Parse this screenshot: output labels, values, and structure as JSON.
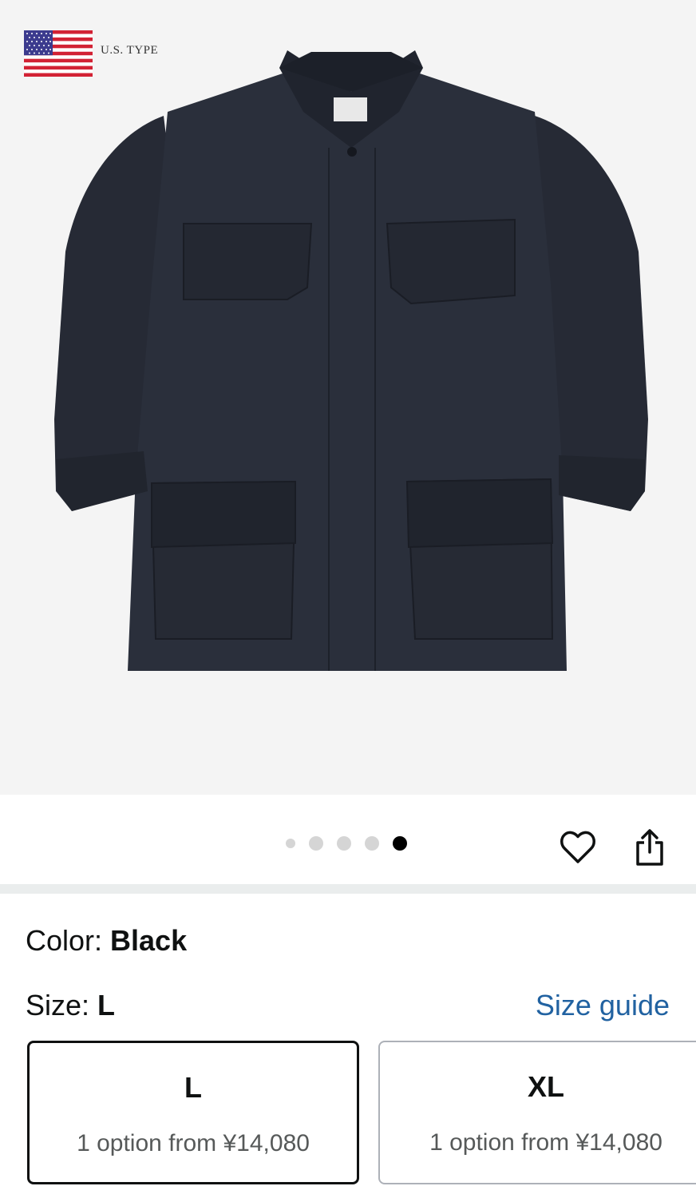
{
  "product_image": {
    "badge_text": "U.S. TYPE",
    "flag_icon": "us-flag-icon",
    "carousel": {
      "total": 5,
      "active": 5
    }
  },
  "actions": {
    "wishlist_icon": "heart-icon",
    "share_icon": "share-icon"
  },
  "variation": {
    "color_label": "Color: ",
    "color_value": "Black",
    "size_label": "Size: ",
    "size_value": "L",
    "size_guide": "Size guide"
  },
  "size_options": [
    {
      "size": "L",
      "offer": "1 option from ¥14,080",
      "selected": true
    },
    {
      "size": "XL",
      "offer": "1 option from ¥14,080",
      "selected": false
    }
  ],
  "colors": {
    "link": "#2162a1",
    "selected_border": "#0f1111",
    "unselected_border": "#adb1b8",
    "active_dot": "#000000",
    "inactive_dot": "#d5d5d5"
  }
}
